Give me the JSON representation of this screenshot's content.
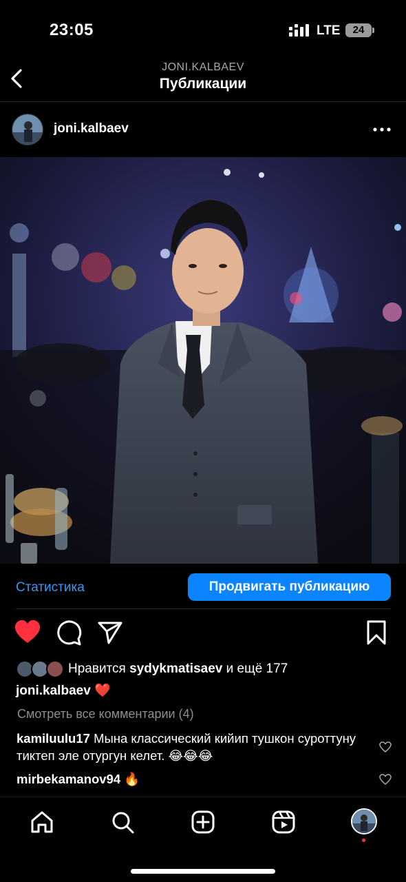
{
  "status_bar": {
    "time": "23:05",
    "network": "LTE",
    "battery": "24"
  },
  "header": {
    "subtitle": "JONI.KALBAEV",
    "title": "Публикации"
  },
  "post": {
    "username": "joni.kalbaev",
    "stats_label": "Статистика",
    "promote_label": "Продвигать публикацию",
    "likes_prefix": "Нравится",
    "likes_user": "sydykmatisaev",
    "likes_suffix": "и ещё 177",
    "caption_user": "joni.kalbaev",
    "caption_text": "❤️",
    "view_all": "Смотреть все комментарии (4)",
    "comments": [
      {
        "user": "kamiluulu17",
        "text": "Мына классический кийип тушкон суроттуну  тиктеп эле отургун келет. 😂😂😂"
      },
      {
        "user": "mirbekamanov94",
        "text": "🔥"
      }
    ]
  },
  "icons": {
    "like": "heart-icon",
    "comment": "comment-icon",
    "share": "send-icon",
    "save": "bookmark-icon"
  },
  "colors": {
    "like": "#ff3040",
    "link": "#3897f0",
    "button": "#0a84ff"
  }
}
